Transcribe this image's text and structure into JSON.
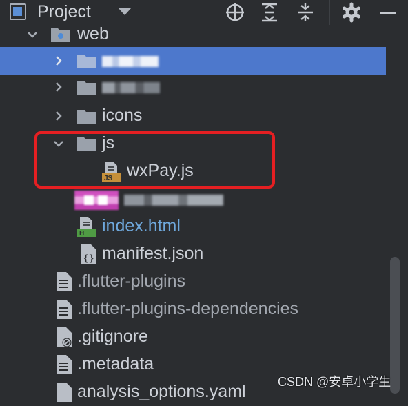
{
  "toolbar": {
    "title": "Project",
    "icons": [
      "locate-icon",
      "expand-all-icon",
      "collapse-all-icon",
      "gear-icon",
      "hide-icon"
    ]
  },
  "tree": {
    "web_label": "web",
    "icons_label": "icons",
    "js_label": "js",
    "wxpay_label": "wxPay.js",
    "wxpay_badge": "JS",
    "index_label": "index.html",
    "index_badge": "H",
    "manifest_label": "manifest.json",
    "manifest_badge": "{}",
    "flutter_plugins_label": ".flutter-plugins",
    "flutter_plugins_deps_label": ".flutter-plugins-dependencies",
    "gitignore_label": ".gitignore",
    "metadata_label": ".metadata",
    "analysis_label": "analysis_options.yaml"
  },
  "watermark": "CSDN @安卓小学生",
  "colors": {
    "background": "#2b2d30",
    "selection": "#4d78cc",
    "highlight": "#e51f22",
    "link_text": "#6fa8dc",
    "js_badge": "#c6903a",
    "html_badge": "#4f9b44"
  }
}
